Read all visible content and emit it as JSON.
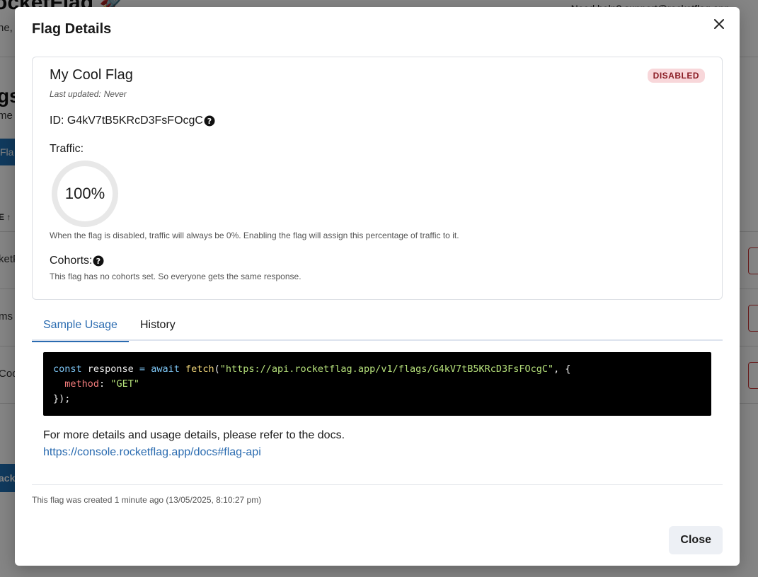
{
  "background": {
    "app_title": "ocketFlag 🚀",
    "subtitle": "ne, a",
    "help_text": "Need help? support@rocketflag.app",
    "section_heading": "gs",
    "section_text": "me",
    "new_button": "Fla",
    "column_header": "E ↑",
    "rows": [
      "ketF",
      "ms",
      "Coo"
    ],
    "back_button": "ack"
  },
  "modal": {
    "title": "Flag Details",
    "close_icon": "close-icon",
    "flag": {
      "name": "My Cool Flag",
      "status": "DISABLED",
      "last_updated_label": "Last updated:",
      "last_updated_value": "Never",
      "id_label": "ID:",
      "id_value": "G4kV7tB5KRcD3FsFOcgC",
      "help_icon": "question-circle-icon",
      "traffic_label": "Traffic:",
      "traffic_value": "100%",
      "traffic_percent": 100,
      "traffic_note": "When the flag is disabled, traffic will always be 0%. Enabling the flag will assign this percentage of traffic to it.",
      "cohorts_label": "Cohorts:",
      "cohorts_note": "This flag has no cohorts set. So everyone gets the same response."
    },
    "tabs": [
      {
        "label": "Sample Usage",
        "active": true
      },
      {
        "label": "History",
        "active": false
      }
    ],
    "code": {
      "l1_const": "const",
      "l1_var": " response ",
      "l1_eq": "=",
      "l1_await": " await ",
      "l1_fetch": "fetch",
      "l1_open": "(",
      "l1_url": "\"https://api.rocketflag.app/v1/flags/G4kV7tB5KRcD3FsFOcgC\"",
      "l1_close": ", {",
      "l2_prop": "method",
      "l2_colon": ": ",
      "l2_val": "\"GET\"",
      "l3": "});"
    },
    "docs_text": "For more details and usage details, please refer to the docs.",
    "docs_link": "https://console.rocketflag.app/docs#flag-api",
    "created_text": "This flag was created 1 minute ago (13/05/2025, 8:10:27 pm)",
    "close_button": "Close"
  },
  "colors": {
    "accent": "#2a6bb0",
    "badge_bg": "#f8d7da",
    "badge_text": "#8a1c24",
    "ring": "#e8e8e8"
  }
}
